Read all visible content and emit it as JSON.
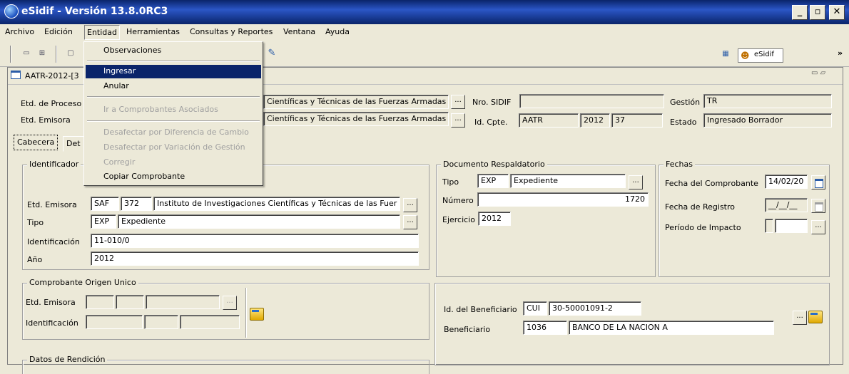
{
  "window": {
    "title": "eSidif - Versión 13.8.0RC3",
    "min": "_",
    "max": "▫",
    "close": "✕"
  },
  "menu": {
    "archivo": "Archivo",
    "edicion": "Edición",
    "entidad": "Entidad",
    "herramientas": "Herramientas",
    "consultas": "Consultas y Reportes",
    "ventana": "Ventana",
    "ayuda": "Ayuda"
  },
  "toolbar": {
    "esidif": "eSidif",
    "more": "»"
  },
  "dropdown": {
    "observaciones": "Observaciones",
    "ingresar": "Ingresar",
    "anular": "Anular",
    "ir_comprobantes": "Ir a Comprobantes Asociados",
    "desafectar_cambio": "Desafectar por Diferencia de Cambio",
    "desafectar_gestion": "Desafectar por Variación de Gestión",
    "corregir": "Corregir",
    "copiar": "Copiar Comprobante"
  },
  "doc": {
    "title": "AATR-2012-[3",
    "etd_proceso_label": "Etd. de Proceso",
    "etd_proceso_value": "Científicas y Técnicas de las Fuerzas Armadas",
    "etd_emisora_label": "Etd. Emisora",
    "etd_emisora_value": "Científicas y Técnicas de las Fuerzas Armadas",
    "nro_sidif_label": "Nro. SIDIF",
    "nro_sidif_value": "",
    "id_cpte_label": "Id. Cpte.",
    "id_cpte_tipo": "AATR",
    "id_cpte_anio": "2012",
    "id_cpte_num": "37",
    "gestion_label": "Gestión",
    "gestion_value": "TR",
    "estado_label": "Estado",
    "estado_value": "Ingresado Borrador"
  },
  "tabs": {
    "cabecera": "Cabecera",
    "det": "Det"
  },
  "identificador": {
    "title": "Identificador",
    "etd_label": "Etd. Emisora",
    "etd_saf": "SAF",
    "etd_num": "372",
    "etd_name": "Instituto de Investigaciones Científicas y Técnicas de las Fuer",
    "tipo_label": "Tipo",
    "tipo_code": "EXP",
    "tipo_desc": "Expediente",
    "ident_label": "Identificación",
    "ident_value": "11-010/0",
    "anio_label": "Año",
    "anio_value": "2012"
  },
  "respaldatorio": {
    "title": "Documento Respaldatorio",
    "tipo_label": "Tipo",
    "tipo_code": "EXP",
    "tipo_desc": "Expediente",
    "numero_label": "Número",
    "numero_value": "1720",
    "ejercicio_label": "Ejercicio",
    "ejercicio_value": "2012"
  },
  "fechas": {
    "title": "Fechas",
    "comprobante_label": "Fecha del Comprobante",
    "comprobante_value": "14/02/20",
    "registro_label": "Fecha de Registro",
    "registro_value": "__/__/__",
    "impacto_label": "Período de Impacto"
  },
  "origen": {
    "title": "Comprobante Origen Unico",
    "etd_label": "Etd. Emisora",
    "ident_label": "Identificación"
  },
  "beneficiario": {
    "id_label": "Id. del Beneficiario",
    "id_tipo": "CUI",
    "id_value": "30-50001091-2",
    "ben_label": "Beneficiario",
    "ben_code": "1036",
    "ben_name": "BANCO DE LA NACION A"
  },
  "rendicion": {
    "title": "Datos de Rendición"
  },
  "ui": {
    "dots": "..."
  }
}
